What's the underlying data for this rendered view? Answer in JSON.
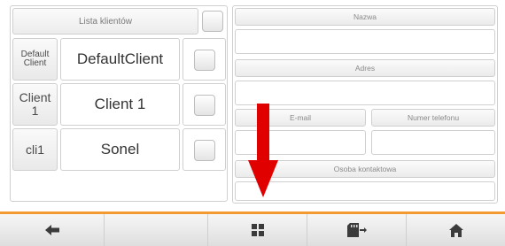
{
  "client_list": {
    "header_label": "Lista klientów",
    "rows": [
      {
        "code": "Default Client",
        "name": "DefaultClient"
      },
      {
        "code": "Client 1",
        "name": "Client 1"
      },
      {
        "code": "cli1",
        "name": "Sonel"
      }
    ]
  },
  "form": {
    "name_label": "Nazwa",
    "address_label": "Adres",
    "email_label": "E-mail",
    "phone_label": "Numer telefonu",
    "contact_label": "Osoba kontaktowa"
  },
  "toolbar": {
    "buttons": [
      {
        "icon": "back-arrow-icon"
      },
      {
        "icon": "empty"
      },
      {
        "icon": "grid-icon"
      },
      {
        "icon": "sd-card-export-icon"
      },
      {
        "icon": "home-icon"
      }
    ]
  },
  "colors": {
    "accent": "#f39a33",
    "arrow": "#e00000"
  }
}
